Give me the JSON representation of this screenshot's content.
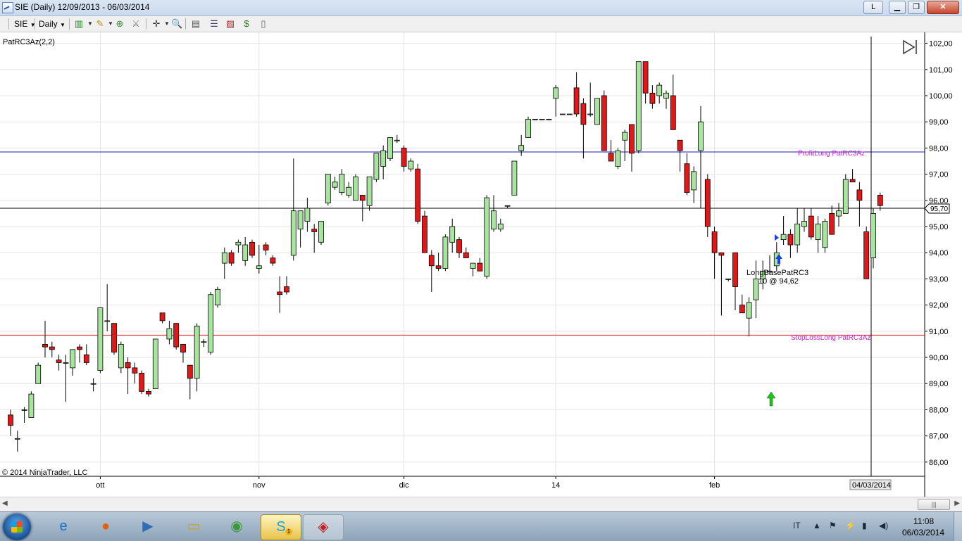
{
  "window": {
    "title": "SIE (Daily)  12/09/2013 - 06/03/2014",
    "l_button": "L",
    "min_icon": "minimize-icon",
    "max_icon": "maximize-icon",
    "close_icon": "close-icon"
  },
  "toolbar": {
    "instrument": "SIE",
    "interval": "Daily"
  },
  "chart": {
    "indicator_label": "PatRC3Az(2,2)",
    "copyright": "© 2014 NinjaTrader, LLC",
    "current_price_label": "95,70",
    "cursor_date_label": "04/03/2014",
    "profit_label": "ProfitLong PatRC3Az",
    "stoploss_label": "StopLossLong PatRC3Az",
    "entry_label_1": "LongBasePatRC3",
    "entry_label_2": "10 @ 94,62",
    "colors": {
      "up": "#a8e4a0",
      "down": "#e01818",
      "profit_line": "#1818b0",
      "stop_line": "#e01818",
      "label_text": "#cc22cc"
    }
  },
  "chart_data": {
    "type": "candlestick",
    "ylim": [
      85.6,
      102.2
    ],
    "y_ticks": [
      "102,00",
      "101,00",
      "100,00",
      "99,00",
      "98,00",
      "97,00",
      "96,00",
      "95,00",
      "94,00",
      "93,00",
      "92,00",
      "91,00",
      "90,00",
      "89,00",
      "88,00",
      "87,00",
      "86,00"
    ],
    "x_labels": [
      {
        "label": "ott",
        "index": 13
      },
      {
        "label": "nov",
        "index": 36
      },
      {
        "label": "dic",
        "index": 57
      },
      {
        "label": "14",
        "index": 79
      },
      {
        "label": "feb",
        "index": 102
      }
    ],
    "levels": {
      "profit_target": 97.85,
      "stop_loss": 90.85,
      "last_price": 95.7
    },
    "entry": {
      "index": 108,
      "price": 94.62
    },
    "ohlc": [
      [
        87.8,
        88.0,
        87.0,
        87.4
      ],
      [
        86.9,
        87.2,
        86.4,
        86.9
      ],
      [
        88.0,
        88.1,
        87.5,
        88.0
      ],
      [
        87.7,
        88.7,
        87.7,
        88.6
      ],
      [
        89.0,
        89.8,
        89.0,
        89.7
      ],
      [
        90.5,
        91.4,
        90.0,
        90.4
      ],
      [
        90.4,
        90.6,
        90.0,
        90.3
      ],
      [
        89.9,
        90.1,
        89.5,
        89.8
      ],
      [
        89.8,
        90.1,
        88.3,
        89.8
      ],
      [
        89.6,
        90.3,
        89.3,
        90.3
      ],
      [
        90.4,
        90.5,
        89.8,
        90.3
      ],
      [
        90.1,
        90.5,
        89.7,
        89.8
      ],
      [
        89.0,
        89.2,
        88.7,
        89.0
      ],
      [
        89.5,
        91.8,
        89.4,
        91.9
      ],
      [
        91.4,
        92.8,
        91.0,
        91.4
      ],
      [
        91.3,
        91.3,
        90.1,
        90.2
      ],
      [
        89.6,
        90.6,
        89.4,
        90.5
      ],
      [
        89.8,
        90.0,
        88.6,
        89.6
      ],
      [
        89.6,
        89.8,
        89.0,
        89.4
      ],
      [
        89.4,
        89.5,
        88.6,
        88.7
      ],
      [
        88.7,
        88.8,
        88.5,
        88.6
      ],
      [
        88.8,
        90.7,
        88.8,
        90.7
      ],
      [
        91.7,
        91.7,
        91.3,
        91.4
      ],
      [
        90.7,
        91.4,
        90.5,
        91.1
      ],
      [
        91.3,
        91.3,
        90.3,
        90.4
      ],
      [
        90.5,
        90.5,
        89.8,
        90.2
      ],
      [
        89.7,
        89.7,
        88.4,
        89.2
      ],
      [
        89.2,
        91.3,
        88.7,
        91.2
      ],
      [
        90.6,
        90.7,
        90.4,
        90.6
      ],
      [
        90.2,
        92.5,
        90.1,
        92.4
      ],
      [
        92.0,
        92.7,
        91.9,
        92.6
      ],
      [
        93.6,
        94.2,
        93.0,
        94.0
      ],
      [
        94.0,
        94.1,
        93.5,
        93.6
      ],
      [
        94.3,
        94.5,
        94.0,
        94.4
      ],
      [
        93.7,
        94.6,
        93.5,
        94.3
      ],
      [
        94.4,
        94.5,
        93.8,
        93.9
      ],
      [
        93.4,
        94.3,
        93.2,
        93.5
      ],
      [
        94.3,
        94.4,
        93.9,
        94.1
      ],
      [
        93.8,
        93.9,
        93.5,
        93.6
      ],
      [
        92.5,
        93.1,
        91.7,
        92.4
      ],
      [
        92.7,
        93.1,
        92.4,
        92.5
      ],
      [
        93.9,
        97.6,
        93.7,
        95.6
      ],
      [
        94.9,
        95.6,
        94.2,
        95.6
      ],
      [
        95.2,
        96.1,
        94.8,
        95.7
      ],
      [
        94.9,
        95.1,
        94.0,
        94.8
      ],
      [
        94.4,
        95.2,
        94.3,
        95.2
      ],
      [
        95.9,
        97.0,
        95.8,
        97.0
      ],
      [
        96.5,
        96.9,
        96.4,
        96.7
      ],
      [
        96.3,
        97.2,
        96.2,
        97.0
      ],
      [
        96.2,
        96.7,
        96.1,
        96.5
      ],
      [
        96.0,
        97.0,
        96.0,
        96.9
      ],
      [
        96.2,
        96.2,
        95.2,
        96.0
      ],
      [
        95.8,
        96.9,
        95.6,
        96.9
      ],
      [
        96.8,
        97.8,
        96.7,
        97.8
      ],
      [
        97.3,
        98.1,
        96.8,
        97.9
      ],
      [
        97.6,
        98.4,
        97.5,
        98.4
      ],
      [
        98.3,
        98.5,
        98.2,
        98.3
      ],
      [
        98.0,
        98.1,
        97.1,
        97.3
      ],
      [
        97.2,
        97.6,
        97.1,
        97.5
      ],
      [
        97.2,
        97.4,
        95.1,
        95.2
      ],
      [
        95.4,
        95.6,
        94.2,
        94.0
      ],
      [
        93.9,
        94.1,
        92.5,
        93.5
      ],
      [
        93.5,
        94.0,
        93.3,
        93.4
      ],
      [
        93.4,
        94.7,
        93.3,
        94.6
      ],
      [
        94.4,
        95.3,
        94.0,
        95.0
      ],
      [
        94.5,
        94.6,
        93.8,
        94.0
      ],
      [
        94.0,
        94.2,
        93.8,
        93.8
      ],
      [
        93.4,
        93.6,
        93.1,
        93.6
      ],
      [
        93.6,
        93.8,
        93.3,
        93.3
      ],
      [
        93.1,
        96.2,
        93.0,
        96.1
      ],
      [
        94.9,
        96.2,
        94.8,
        95.6
      ],
      [
        94.9,
        95.3,
        94.8,
        95.1
      ],
      [
        95.8,
        95.8,
        95.7,
        95.8
      ],
      [
        96.2,
        97.5,
        96.2,
        97.5
      ],
      [
        97.9,
        98.5,
        97.7,
        98.1
      ],
      [
        98.4,
        99.2,
        98.4,
        99.1
      ],
      [
        99.1,
        99.1,
        99.1,
        99.1
      ],
      [
        99.1,
        99.1,
        99.1,
        99.1
      ],
      [
        99.1,
        99.1,
        99.1,
        99.1
      ],
      [
        99.9,
        100.4,
        99.2,
        100.3
      ],
      [
        99.3,
        99.3,
        99.3,
        99.3
      ],
      [
        99.3,
        99.3,
        99.3,
        99.3
      ],
      [
        100.3,
        100.9,
        99.2,
        99.3
      ],
      [
        99.7,
        99.9,
        97.6,
        98.9
      ],
      [
        99.3,
        100.5,
        99.2,
        99.3
      ],
      [
        98.9,
        99.8,
        98.9,
        99.9
      ],
      [
        100.0,
        100.2,
        98.1,
        97.9
      ],
      [
        97.8,
        98.3,
        97.6,
        97.5
      ],
      [
        97.3,
        98.0,
        97.2,
        97.9
      ],
      [
        98.3,
        98.7,
        97.5,
        98.6
      ],
      [
        98.9,
        98.9,
        97.1,
        97.8
      ],
      [
        97.9,
        101.3,
        97.8,
        101.3
      ],
      [
        101.3,
        101.1,
        99.7,
        100.1
      ],
      [
        100.1,
        100.4,
        99.5,
        99.7
      ],
      [
        100.0,
        100.5,
        99.7,
        100.4
      ],
      [
        99.9,
        100.2,
        99.5,
        100.1
      ],
      [
        100.0,
        100.8,
        99.9,
        98.7
      ],
      [
        98.3,
        98.3,
        97.1,
        97.9
      ],
      [
        97.4,
        97.8,
        96.2,
        96.3
      ],
      [
        96.4,
        97.3,
        95.9,
        97.1
      ],
      [
        97.9,
        99.6,
        95.7,
        99.0
      ],
      [
        96.8,
        97.0,
        94.6,
        95.0
      ],
      [
        94.8,
        95.0,
        93.0,
        94.0
      ],
      [
        94.0,
        94.0,
        91.6,
        93.9
      ],
      [
        93.0,
        93.0,
        92.9,
        93.0
      ],
      [
        94.0,
        94.0,
        91.8,
        92.7
      ],
      [
        92.0,
        92.4,
        92.0,
        91.7
      ],
      [
        91.5,
        92.3,
        90.8,
        92.1
      ],
      [
        92.2,
        93.7,
        91.5,
        93.0
      ],
      [
        93.0,
        93.7,
        92.6,
        93.3
      ],
      [
        93.3,
        93.9,
        93.2,
        93.3
      ],
      [
        93.5,
        94.4,
        93.3,
        94.0
      ],
      [
        94.5,
        95.4,
        94.3,
        94.7
      ],
      [
        94.7,
        94.9,
        93.8,
        94.3
      ],
      [
        94.3,
        95.7,
        94.0,
        95.1
      ],
      [
        95.0,
        95.7,
        94.8,
        95.2
      ],
      [
        95.4,
        95.7,
        94.5,
        94.6
      ],
      [
        94.5,
        95.4,
        94.0,
        95.1
      ],
      [
        94.2,
        95.3,
        94.0,
        95.2
      ],
      [
        95.5,
        95.8,
        94.7,
        94.7
      ],
      [
        95.4,
        95.9,
        95.0,
        95.6
      ],
      [
        95.5,
        97.0,
        95.6,
        96.8
      ],
      [
        96.8,
        97.2,
        96.7,
        96.7
      ],
      [
        96.4,
        96.7,
        95.0,
        96.0
      ],
      [
        94.8,
        95.0,
        93.3,
        93.0
      ],
      [
        93.8,
        95.7,
        93.4,
        95.5
      ],
      [
        96.2,
        96.3,
        95.6,
        95.8
      ]
    ]
  },
  "scrollbar": {
    "thumb_label": "|||"
  },
  "taskbar": {
    "start_icon": "windows-start-icon",
    "tasks": [
      "internet-explorer-icon",
      "firefox-icon",
      "media-player-icon",
      "file-explorer-icon",
      "chrome-icon",
      "skype-icon",
      "ninjatrader-icon"
    ],
    "skype_badge": "1",
    "language": "IT",
    "clock_time": "11:08",
    "clock_date": "06/03/2014"
  }
}
